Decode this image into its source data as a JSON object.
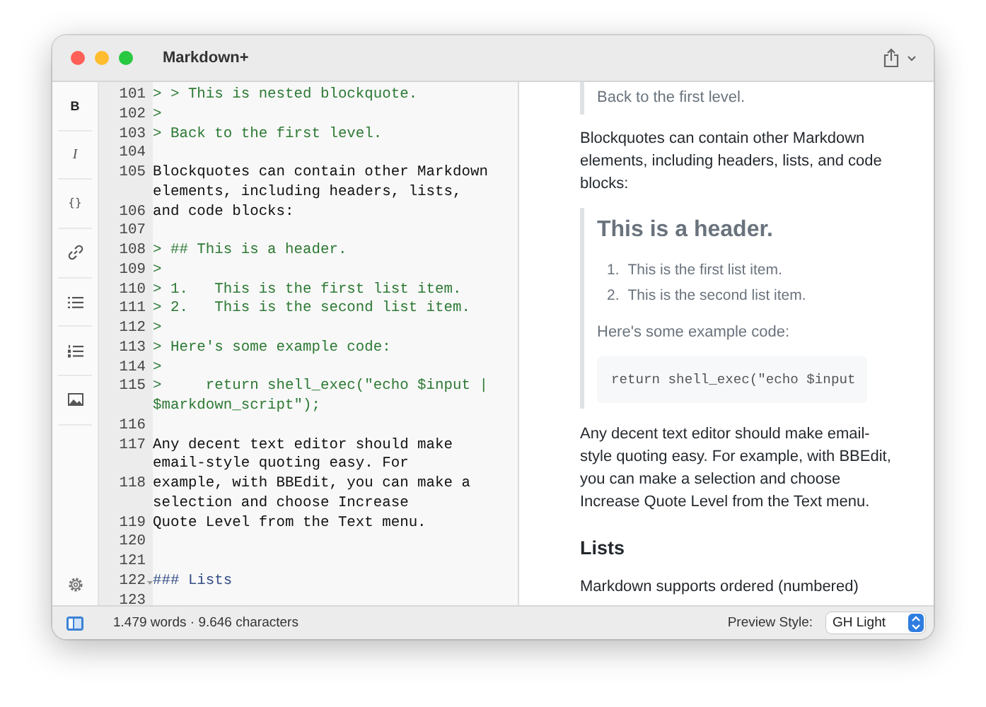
{
  "window": {
    "title": "Markdown+"
  },
  "toolbar": {
    "format_buttons": [
      "B",
      "I",
      "{}"
    ]
  },
  "editor": {
    "lines": [
      {
        "number": "101",
        "kind": "quote",
        "text": "> > This is nested blockquote.",
        "foldable": false
      },
      {
        "number": "102",
        "kind": "quote",
        "text": ">",
        "foldable": false
      },
      {
        "number": "103",
        "kind": "quote",
        "text": "> Back to the first level.",
        "foldable": false
      },
      {
        "number": "104",
        "foldable": false
      },
      {
        "number": "105",
        "kind": "text",
        "text": "Blockquotes can contain other Markdown elements, including headers, lists,",
        "foldable": false
      },
      {
        "number": "106",
        "kind": "text",
        "text": "and code blocks:",
        "foldable": false
      },
      {
        "number": "107",
        "foldable": false
      },
      {
        "number": "108",
        "kind": "quote",
        "text": "> ## This is a header.",
        "foldable": false
      },
      {
        "number": "109",
        "kind": "quote",
        "text": ">",
        "foldable": false
      },
      {
        "number": "110",
        "kind": "quote",
        "text": "> 1.   This is the first list item.",
        "foldable": false
      },
      {
        "number": "111",
        "kind": "quote",
        "text": "> 2.   This is the second list item.",
        "foldable": false
      },
      {
        "number": "112",
        "kind": "quote",
        "text": ">",
        "foldable": false
      },
      {
        "number": "113",
        "kind": "quote",
        "text": "> Here's some example code:",
        "foldable": false
      },
      {
        "number": "114",
        "kind": "quote",
        "text": ">",
        "foldable": false
      },
      {
        "number": "115",
        "kind": "quote",
        "text": ">     return shell_exec(\"echo $input | $markdown_script\");",
        "foldable": false
      },
      {
        "number": "116",
        "foldable": false
      },
      {
        "number": "117",
        "kind": "text",
        "text": "Any decent text editor should make email-style quoting easy. For",
        "foldable": false
      },
      {
        "number": "118",
        "kind": "text",
        "text": "example, with BBEdit, you can make a selection and choose Increase",
        "foldable": false
      },
      {
        "number": "119",
        "kind": "text",
        "text": "Quote Level from the Text menu.",
        "foldable": false
      },
      {
        "number": "120",
        "foldable": false
      },
      {
        "number": "121",
        "foldable": false
      },
      {
        "number": "122",
        "kind": "header",
        "text": "### Lists",
        "foldable": true
      },
      {
        "number": "123",
        "foldable": false
      }
    ]
  },
  "preview": {
    "blocks": [
      {
        "kind": "blockquote",
        "children": [
          {
            "kind": "paragraph",
            "text": "Back to the first level."
          }
        ]
      },
      {
        "kind": "paragraph",
        "text": "Blockquotes can contain other Markdown elements, including headers, lists, and code blocks:"
      },
      {
        "kind": "blockquote",
        "children": [
          {
            "kind": "heading2",
            "text": "This is a header."
          },
          {
            "kind": "ordered_list",
            "items": [
              {
                "number": "1.",
                "text": "This is the first list item."
              },
              {
                "number": "2.",
                "text": "This is the second list item."
              }
            ]
          },
          {
            "kind": "paragraph",
            "text": "Here's some example code:"
          },
          {
            "kind": "code",
            "text": "return shell_exec(\"echo $input"
          }
        ]
      },
      {
        "kind": "paragraph",
        "text": "Any decent text editor should make email-style quoting easy. For example, with BBEdit, you can make a selection and choose Increase Quote Level from the Text menu."
      },
      {
        "kind": "heading3",
        "text": "Lists"
      },
      {
        "kind": "paragraph",
        "text": "Markdown supports ordered (numbered)"
      }
    ]
  },
  "status_bar": {
    "counts": "1.479 words · 9.646 characters",
    "preview_style_label": "Preview Style:",
    "preview_style": "GH Light"
  }
}
